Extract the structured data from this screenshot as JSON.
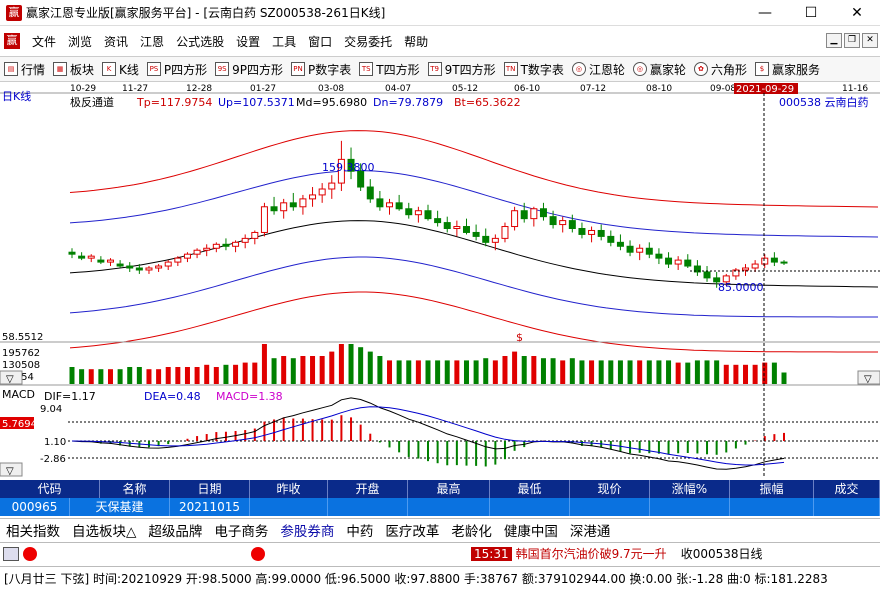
{
  "window": {
    "app_icon": "赢",
    "title": "赢家江恩专业版[赢家服务平台] - [云南白药  SZ000538-261日K线]",
    "minimize": "—",
    "maximize": "☐",
    "close": "✕"
  },
  "menu": {
    "app_icon": "赢",
    "items": [
      "文件",
      "浏览",
      "资讯",
      "江恩",
      "公式选股",
      "设置",
      "工具",
      "窗口",
      "交易委托",
      "帮助"
    ]
  },
  "toolbar": {
    "items": [
      {
        "icon": "▤",
        "label": "行情"
      },
      {
        "icon": "▦",
        "label": "板块"
      },
      {
        "icon": "K",
        "label": "K线"
      },
      {
        "icon": "PS",
        "label": "P四方形"
      },
      {
        "icon": "9S",
        "label": "9P四方形"
      },
      {
        "icon": "PN",
        "label": "P数字表"
      },
      {
        "icon": "TS",
        "label": "T四方形"
      },
      {
        "icon": "T9",
        "label": "9T四方形"
      },
      {
        "icon": "TN",
        "label": "T数字表"
      },
      {
        "icon": "◎",
        "label": "江恩轮"
      },
      {
        "icon": "◎",
        "label": "赢家轮"
      },
      {
        "icon": "✿",
        "label": "六角形"
      },
      {
        "icon": "$",
        "label": "赢家服务"
      }
    ]
  },
  "chart": {
    "kline_label": "日K线",
    "stock_label": "000538 云南白药",
    "indicator_name": "极反通道",
    "tp": "Tp=117.9754",
    "up": "Up=107.5371",
    "md": "Md=95.6980",
    "dn": "Dn=79.7879",
    "bt": "Bt=65.3622",
    "high_label": "159.3800",
    "low_label": "85.0000",
    "dollar_mark": "$",
    "date_ticks": [
      "10-29",
      "11-27",
      "12-28",
      "01-27",
      "03-08",
      "04-07",
      "05-12",
      "06-10",
      "07-12",
      "08-10",
      "09-08",
      "11-16"
    ],
    "cursor_date": "2021-09-29",
    "price_bottom": "58.5512",
    "vol_ticks": [
      "195762",
      "130508",
      "65254"
    ],
    "macd_label": "MACD",
    "dif": "DIF=1.17",
    "dea": "DEA=0.48",
    "macd": "MACD=1.38",
    "macd_ticks": [
      "9.04",
      "1.10",
      "-2.86"
    ],
    "macd_cursor": "5.7694",
    "arrow_down": "▽",
    "colors": {
      "red": "#ff0000",
      "blue": "#0000ff",
      "green": "#008000",
      "upper": "#cc0000",
      "lower": "#0000cc"
    }
  },
  "chart_data": {
    "type": "candlestick",
    "x_range_dates": [
      "10-29",
      "11-16"
    ],
    "kline_ohlc": [
      [
        103,
        105,
        100,
        102
      ],
      [
        101,
        103,
        99,
        100
      ],
      [
        100,
        102,
        98,
        101
      ],
      [
        99,
        101,
        97,
        98
      ],
      [
        98,
        100,
        96,
        99
      ],
      [
        97,
        99,
        95,
        96
      ],
      [
        96,
        98,
        93,
        95
      ],
      [
        95,
        97,
        92,
        94
      ],
      [
        94,
        96,
        92,
        95
      ],
      [
        95,
        97,
        93,
        96
      ],
      [
        96,
        99,
        94,
        98
      ],
      [
        98,
        101,
        96,
        100
      ],
      [
        100,
        103,
        98,
        102
      ],
      [
        102,
        105,
        100,
        104
      ],
      [
        104,
        107,
        101,
        105
      ],
      [
        105,
        108,
        103,
        107
      ],
      [
        107,
        110,
        104,
        106
      ],
      [
        106,
        109,
        103,
        108
      ],
      [
        108,
        112,
        105,
        110
      ],
      [
        110,
        114,
        107,
        113
      ],
      [
        113,
        128,
        111,
        126
      ],
      [
        126,
        131,
        122,
        124
      ],
      [
        124,
        130,
        120,
        128
      ],
      [
        128,
        133,
        124,
        126
      ],
      [
        126,
        132,
        122,
        130
      ],
      [
        130,
        136,
        126,
        132
      ],
      [
        132,
        138,
        128,
        135
      ],
      [
        135,
        142,
        130,
        138
      ],
      [
        138,
        159.38,
        134,
        150
      ],
      [
        150,
        156,
        140,
        144
      ],
      [
        144,
        148,
        134,
        136
      ],
      [
        136,
        140,
        128,
        130
      ],
      [
        130,
        134,
        124,
        126
      ],
      [
        126,
        130,
        122,
        128
      ],
      [
        128,
        132,
        124,
        125
      ],
      [
        125,
        128,
        120,
        122
      ],
      [
        122,
        126,
        118,
        124
      ],
      [
        124,
        127,
        119,
        120
      ],
      [
        120,
        124,
        116,
        118
      ],
      [
        118,
        121,
        113,
        115
      ],
      [
        115,
        119,
        111,
        116
      ],
      [
        116,
        120,
        112,
        113
      ],
      [
        113,
        117,
        109,
        111
      ],
      [
        111,
        115,
        106,
        108
      ],
      [
        108,
        112,
        104,
        110
      ],
      [
        110,
        118,
        108,
        116
      ],
      [
        116,
        126,
        114,
        124
      ],
      [
        124,
        128,
        118,
        120
      ],
      [
        120,
        126,
        116,
        125
      ],
      [
        125,
        128,
        119,
        121
      ],
      [
        121,
        124,
        115,
        117
      ],
      [
        117,
        121,
        113,
        119
      ],
      [
        119,
        122,
        113,
        115
      ],
      [
        115,
        118,
        110,
        112
      ],
      [
        112,
        116,
        108,
        114
      ],
      [
        114,
        117,
        109,
        111
      ],
      [
        111,
        114,
        106,
        108
      ],
      [
        108,
        112,
        104,
        106
      ],
      [
        106,
        109,
        101,
        103
      ],
      [
        103,
        107,
        99,
        105
      ],
      [
        105,
        108,
        100,
        102
      ],
      [
        102,
        105,
        97,
        100
      ],
      [
        100,
        103,
        95,
        97
      ],
      [
        97,
        101,
        94,
        99
      ],
      [
        99,
        102,
        95,
        96
      ],
      [
        96,
        99,
        91,
        93
      ],
      [
        93,
        96,
        88,
        90
      ],
      [
        90,
        93,
        85,
        88
      ],
      [
        88,
        92,
        86,
        91
      ],
      [
        91,
        95,
        89,
        94
      ],
      [
        94,
        97,
        91,
        95
      ],
      [
        95,
        99,
        93,
        97
      ],
      [
        97,
        102,
        95,
        100
      ],
      [
        100,
        103,
        96,
        98
      ],
      [
        98,
        99,
        96.5,
        97.88
      ]
    ]
  },
  "grid": {
    "headers": [
      "代码",
      "名称",
      "日期",
      "昨收",
      "开盘",
      "最高",
      "最低",
      "现价",
      "涨幅%",
      "振幅",
      "成交"
    ],
    "row": {
      "code": "000965",
      "name": "天保基建",
      "date": "20211015"
    }
  },
  "tags": [
    "相关指数",
    "自选板块△",
    "超级品牌",
    "电子商务",
    "参股券商",
    "中药",
    "医疗改革",
    "老龄化",
    "健康中国",
    "深港通"
  ],
  "status1": {
    "news_time": "15:31",
    "news": "韩国首尔汽油价破9.7元一升",
    "right_text": "收000538日线"
  },
  "status2": {
    "text": "[八月廿三  下弦] 时间:20210929 开:98.5000 高:99.0000 低:96.5000 收:97.8800 手:38767 额:379102944.00 换:0.00 张:-1.28 曲:0 标:181.2283"
  }
}
